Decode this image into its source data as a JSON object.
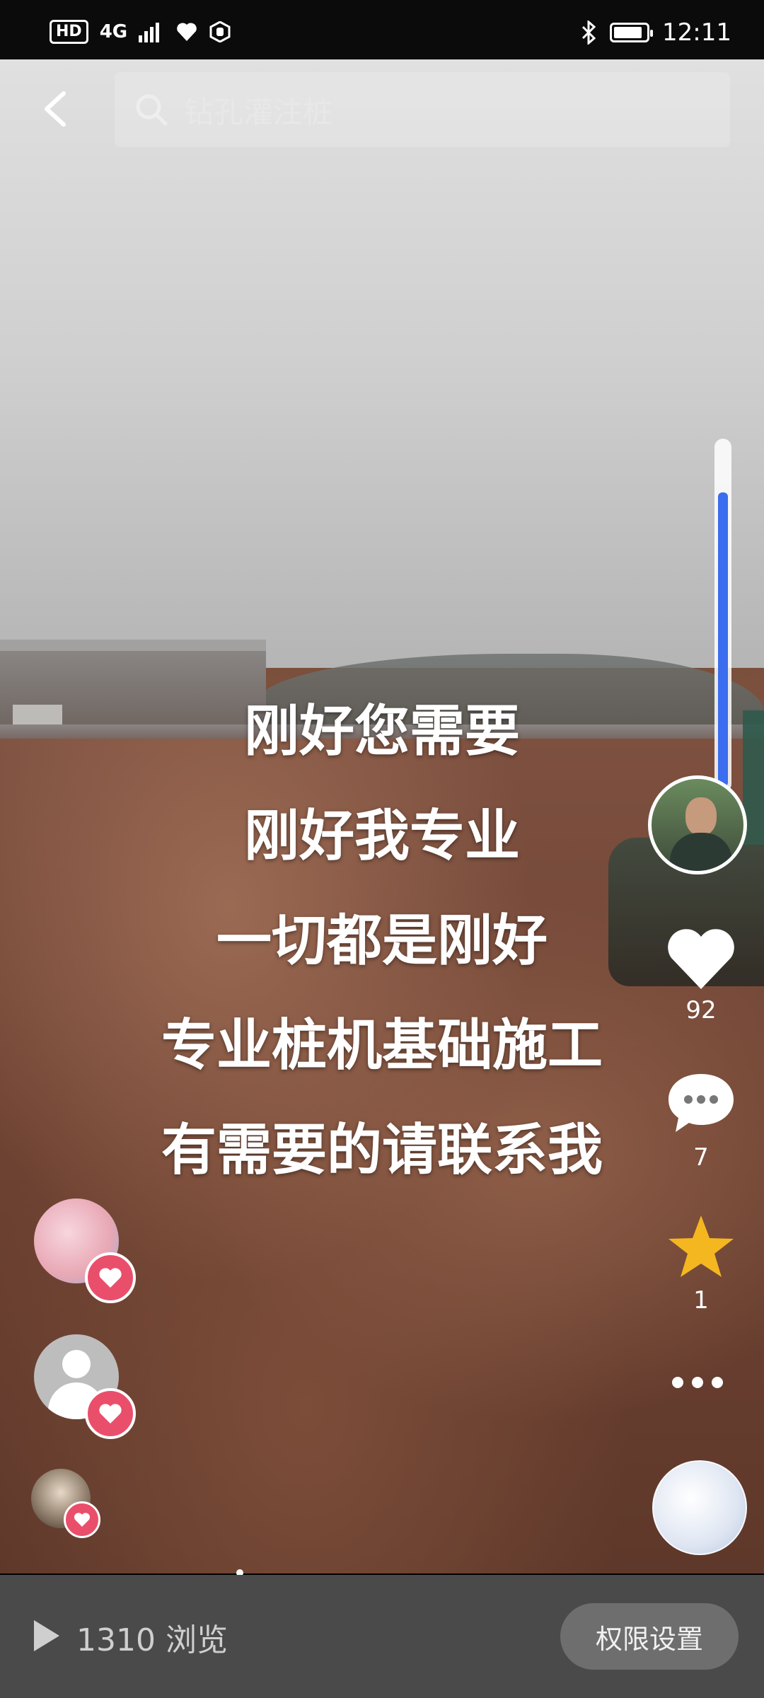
{
  "status_bar": {
    "hd": "HD",
    "network": "4G",
    "time": "12:11"
  },
  "search": {
    "query": "钻孔灌注桩"
  },
  "caption": {
    "lines": [
      "刚好您需要",
      "刚好我专业",
      "一切都是刚好",
      "专业桩机基础施工",
      "有需要的请联系我"
    ]
  },
  "actions": {
    "like_count": "92",
    "comment_count": "7",
    "favorite_count": "1"
  },
  "progress": {
    "fraction": 0.86
  },
  "footer": {
    "views": "1310 浏览",
    "permission_label": "权限设置"
  },
  "colors": {
    "heart_badge": "#e94f6b",
    "star": "#f5b720",
    "progress": "#3a6df0"
  },
  "icons": [
    "back-arrow-icon",
    "search-icon",
    "heart-icon",
    "comment-icon",
    "star-icon",
    "more-icon",
    "play-icon"
  ]
}
